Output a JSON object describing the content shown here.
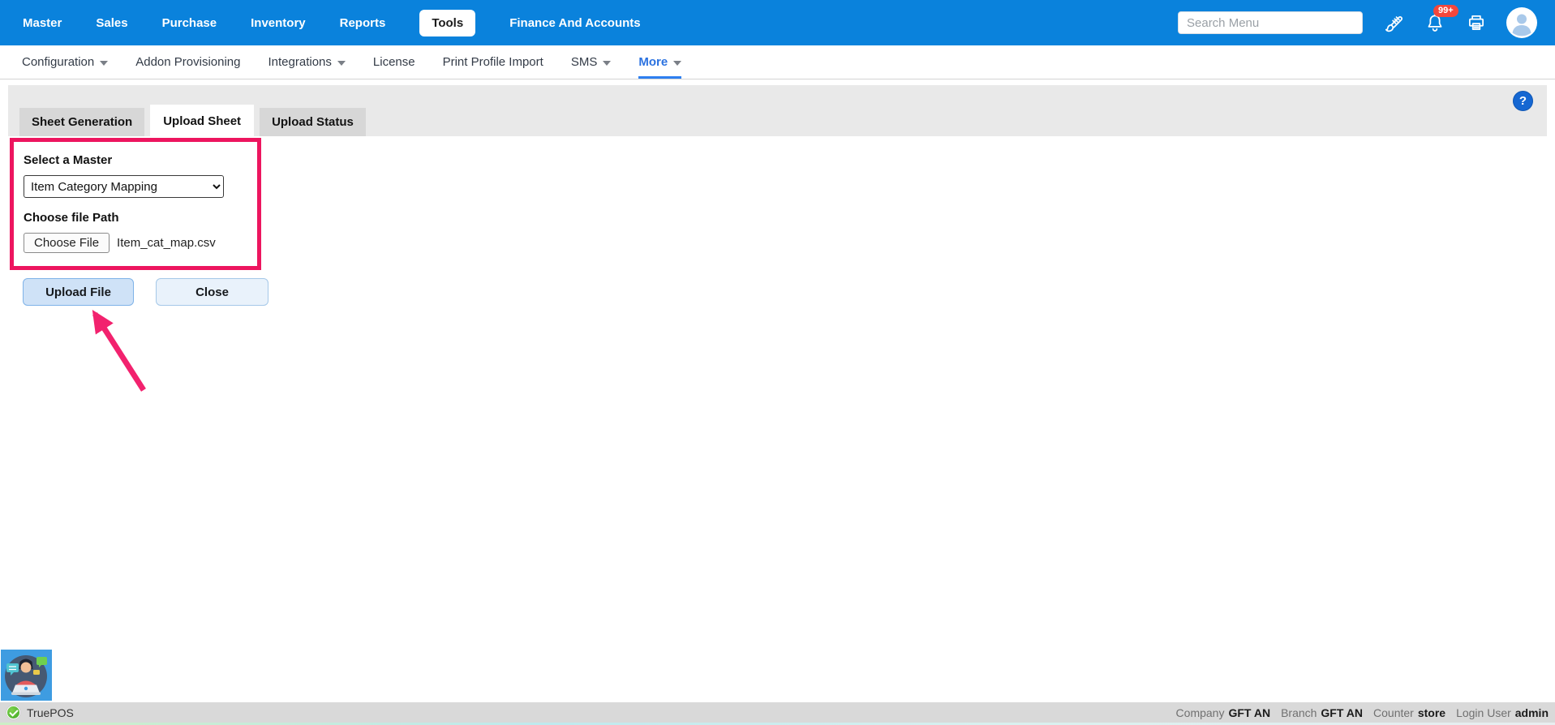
{
  "topbar": {
    "menu": [
      "Master",
      "Sales",
      "Purchase",
      "Inventory",
      "Reports",
      "Tools",
      "Finance And Accounts"
    ],
    "active_item": "Tools",
    "search_placeholder": "Search Menu",
    "notification_badge": "99+"
  },
  "subnav": {
    "items": [
      "Configuration",
      "Addon Provisioning",
      "Integrations",
      "License",
      "Print Profile Import",
      "SMS",
      "More"
    ],
    "active_item": "More"
  },
  "panel": {
    "help_glyph": "?"
  },
  "tabs": [
    "Sheet Generation",
    "Upload Sheet",
    "Upload Status"
  ],
  "active_tab": "Upload Sheet",
  "form": {
    "master_label": "Select a Master",
    "master_value": "Item Category Mapping",
    "file_label": "Choose file Path",
    "choose_file_button": "Choose File",
    "file_name": "Item_cat_map.csv"
  },
  "actions": {
    "upload": "Upload File",
    "close": "Close"
  },
  "statusbar": {
    "app_name": "TruePOS",
    "company_label": "Company",
    "company_value": "GFT AN",
    "branch_label": "Branch",
    "branch_value": "GFT AN",
    "counter_label": "Counter",
    "counter_value": "store",
    "login_label": "Login User",
    "login_value": "admin"
  },
  "colors": {
    "topbar_blue": "#0a82dc",
    "accent_blue": "#2b72e0",
    "annotation_pink": "#ed155f",
    "badge_red": "#f4473c",
    "help_blue": "#1567d2"
  }
}
